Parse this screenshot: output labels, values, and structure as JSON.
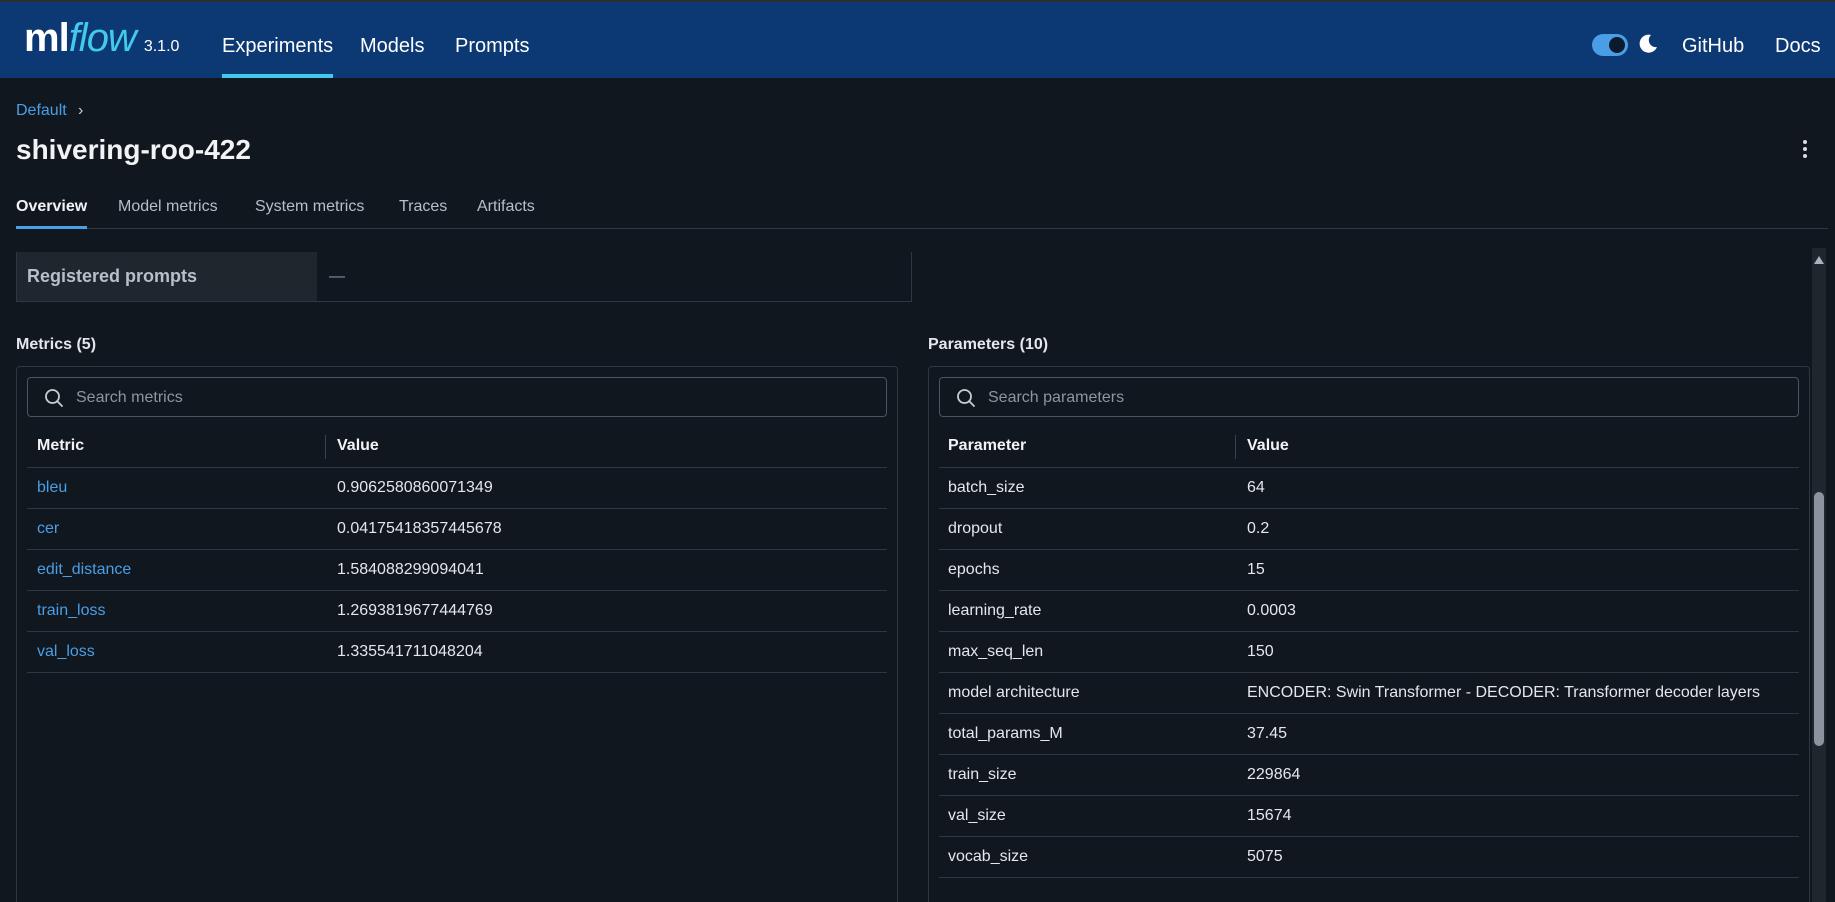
{
  "header": {
    "logo_ml": "ml",
    "logo_flow": "flow",
    "version": "3.1.0",
    "nav": [
      "Experiments",
      "Models",
      "Prompts"
    ],
    "active_nav": "Experiments",
    "right_links": [
      "GitHub",
      "Docs"
    ],
    "dark_mode": true
  },
  "breadcrumb": {
    "parent": "Default",
    "separator": "›"
  },
  "run_title": "shivering-roo-422",
  "tabs": [
    "Overview",
    "Model metrics",
    "System metrics",
    "Traces",
    "Artifacts"
  ],
  "active_tab": "Overview",
  "registered_prompts": {
    "label": "Registered prompts",
    "value": "—"
  },
  "metrics": {
    "heading": "Metrics (5)",
    "search_placeholder": "Search metrics",
    "columns": [
      "Metric",
      "Value"
    ],
    "rows": [
      [
        "bleu",
        "0.9062580860071349"
      ],
      [
        "cer",
        "0.04175418357445678"
      ],
      [
        "edit_distance",
        "1.584088299094041"
      ],
      [
        "train_loss",
        "1.2693819677444769"
      ],
      [
        "val_loss",
        "1.335541711048204"
      ]
    ]
  },
  "parameters": {
    "heading": "Parameters (10)",
    "search_placeholder": "Search parameters",
    "columns": [
      "Parameter",
      "Value"
    ],
    "rows": [
      [
        "batch_size",
        "64"
      ],
      [
        "dropout",
        "0.2"
      ],
      [
        "epochs",
        "15"
      ],
      [
        "learning_rate",
        "0.0003"
      ],
      [
        "max_seq_len",
        "150"
      ],
      [
        "model architecture",
        "ENCODER: Swin Transformer - DECODER: Transformer decoder layers"
      ],
      [
        "total_params_M",
        "37.45"
      ],
      [
        "train_size",
        "229864"
      ],
      [
        "val_size",
        "15674"
      ],
      [
        "vocab_size",
        "5075"
      ]
    ]
  },
  "colors": {
    "accent": "#43c9ed",
    "link": "#4a9ee5",
    "header_bg": "#0c3873",
    "page_bg": "#11171f"
  },
  "icons": [
    "moon-icon",
    "search-icon",
    "kebab-menu-icon",
    "breadcrumb-chevron-icon"
  ]
}
